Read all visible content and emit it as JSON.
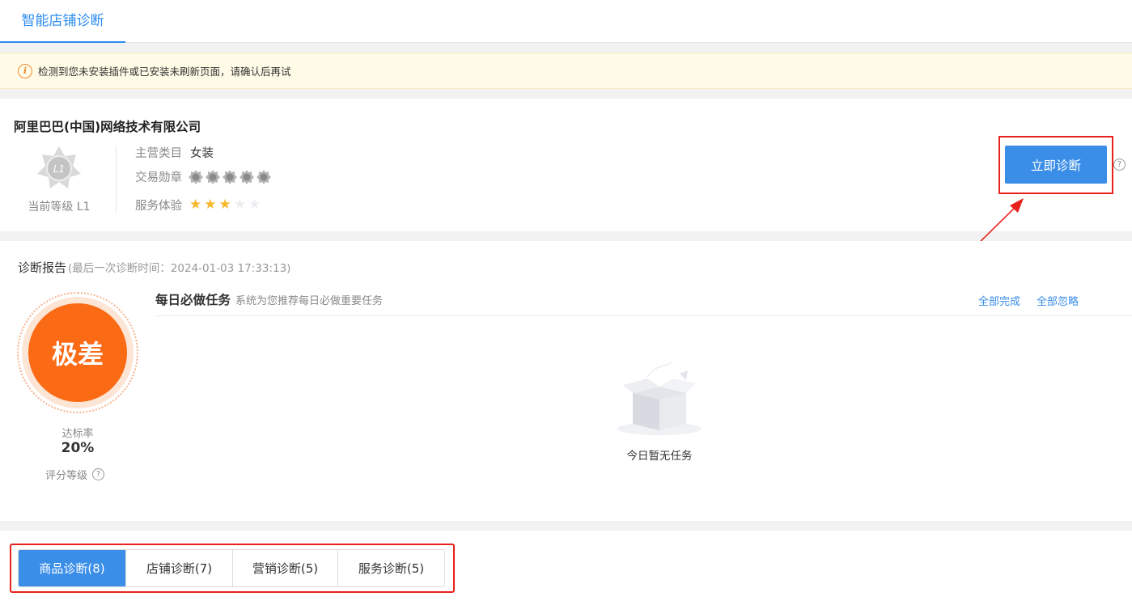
{
  "header": {
    "active_tab": "智能店铺诊断"
  },
  "notice": {
    "icon": "info-icon",
    "text": "检测到您未安装插件或已安装未刷新页面，请确认后再试"
  },
  "shop": {
    "name": "阿里巴巴(中国)网络技术有限公司",
    "level_badge": "L1",
    "level_text": "当前等级 L1",
    "category_label": "主营类目",
    "category_value": "女装",
    "medal_label": "交易勋章",
    "medal_count": 5,
    "service_label": "服务体验",
    "service_rating": 3,
    "service_max": 5,
    "diagnose_button": "立即诊断",
    "help_symbol": "?"
  },
  "report": {
    "title": "诊断报告",
    "last_time": "(最后一次诊断时间：2024-01-03 17:33:13)",
    "grade": "极差",
    "rate_label": "达标率",
    "rate_value": "20%",
    "score_label": "评分等级",
    "help_symbol": "?"
  },
  "tasks": {
    "title": "每日必做任务",
    "subtitle": "系统为您推荐每日必做重要任务",
    "complete_all": "全部完成",
    "ignore_all": "全部忽略",
    "empty_text": "今日暂无任务"
  },
  "diagnosis_tabs": [
    {
      "label": "商品诊断(8)",
      "active": true
    },
    {
      "label": "店铺诊断(7)",
      "active": false
    },
    {
      "label": "营销诊断(5)",
      "active": false
    },
    {
      "label": "服务诊断(5)",
      "active": false
    }
  ],
  "colors": {
    "primary": "#3a8ee8",
    "grade": "#fb6a14",
    "highlight": "#e8211d",
    "star": "#f6b72c"
  }
}
